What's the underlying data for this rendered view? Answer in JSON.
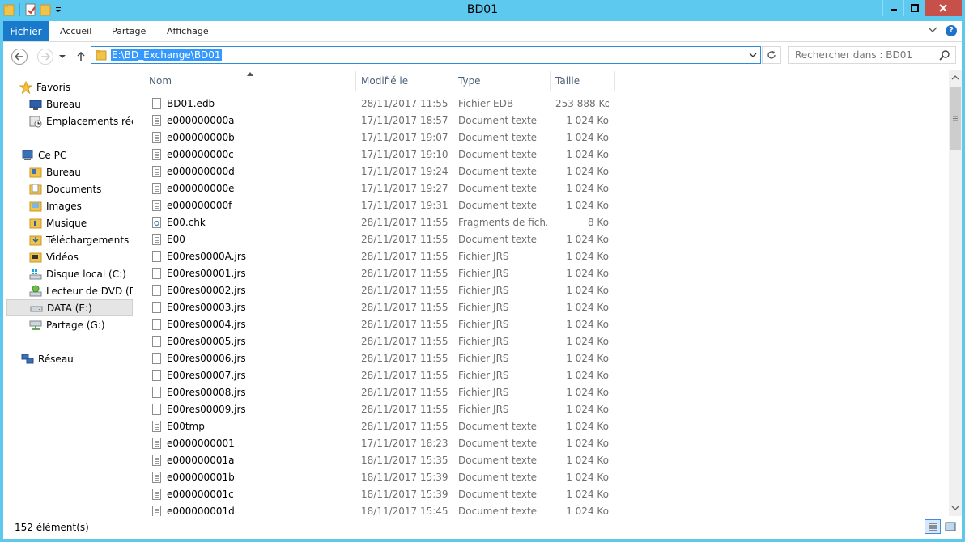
{
  "window": {
    "title": "BD01"
  },
  "ribbon": {
    "tabs": [
      {
        "label": "Fichier"
      },
      {
        "label": "Accueil"
      },
      {
        "label": "Partage"
      },
      {
        "label": "Affichage"
      }
    ]
  },
  "address": {
    "path": "E:\\BD_Exchange\\BD01"
  },
  "search": {
    "placeholder": "Rechercher dans : BD01"
  },
  "nav": {
    "favorites": "Favoris",
    "fav_items": [
      "Bureau",
      "Emplacements récents"
    ],
    "thispc": "Ce PC",
    "pc_items": [
      "Bureau",
      "Documents",
      "Images",
      "Musique",
      "Téléchargements",
      "Vidéos",
      "Disque local (C:)",
      "Lecteur de DVD (D:)",
      "DATA (E:)",
      "Partage (G:)"
    ],
    "network": "Réseau"
  },
  "columns": {
    "name": "Nom",
    "modified": "Modifié le",
    "type": "Type",
    "size": "Taille"
  },
  "files": [
    {
      "name": "BD01.edb",
      "date": "28/11/2017 11:55",
      "type": "Fichier EDB",
      "size": "253 888 Ko",
      "icon": "file-icon"
    },
    {
      "name": "e000000000a",
      "date": "17/11/2017 18:57",
      "type": "Document texte",
      "size": "1 024 Ko",
      "icon": "text-file-icon"
    },
    {
      "name": "e000000000b",
      "date": "17/11/2017 19:07",
      "type": "Document texte",
      "size": "1 024 Ko",
      "icon": "text-file-icon"
    },
    {
      "name": "e000000000c",
      "date": "17/11/2017 19:10",
      "type": "Document texte",
      "size": "1 024 Ko",
      "icon": "text-file-icon"
    },
    {
      "name": "e000000000d",
      "date": "17/11/2017 19:24",
      "type": "Document texte",
      "size": "1 024 Ko",
      "icon": "text-file-icon"
    },
    {
      "name": "e000000000e",
      "date": "17/11/2017 19:27",
      "type": "Document texte",
      "size": "1 024 Ko",
      "icon": "text-file-icon"
    },
    {
      "name": "e000000000f",
      "date": "17/11/2017 19:31",
      "type": "Document texte",
      "size": "1 024 Ko",
      "icon": "text-file-icon"
    },
    {
      "name": "E00.chk",
      "date": "28/11/2017 11:55",
      "type": "Fragments de fich...",
      "size": "8 Ko",
      "icon": "chk-file-icon"
    },
    {
      "name": "E00",
      "date": "28/11/2017 11:55",
      "type": "Document texte",
      "size": "1 024 Ko",
      "icon": "text-file-icon"
    },
    {
      "name": "E00res0000A.jrs",
      "date": "28/11/2017 11:55",
      "type": "Fichier JRS",
      "size": "1 024 Ko",
      "icon": "file-icon"
    },
    {
      "name": "E00res00001.jrs",
      "date": "28/11/2017 11:55",
      "type": "Fichier JRS",
      "size": "1 024 Ko",
      "icon": "file-icon"
    },
    {
      "name": "E00res00002.jrs",
      "date": "28/11/2017 11:55",
      "type": "Fichier JRS",
      "size": "1 024 Ko",
      "icon": "file-icon"
    },
    {
      "name": "E00res00003.jrs",
      "date": "28/11/2017 11:55",
      "type": "Fichier JRS",
      "size": "1 024 Ko",
      "icon": "file-icon"
    },
    {
      "name": "E00res00004.jrs",
      "date": "28/11/2017 11:55",
      "type": "Fichier JRS",
      "size": "1 024 Ko",
      "icon": "file-icon"
    },
    {
      "name": "E00res00005.jrs",
      "date": "28/11/2017 11:55",
      "type": "Fichier JRS",
      "size": "1 024 Ko",
      "icon": "file-icon"
    },
    {
      "name": "E00res00006.jrs",
      "date": "28/11/2017 11:55",
      "type": "Fichier JRS",
      "size": "1 024 Ko",
      "icon": "file-icon"
    },
    {
      "name": "E00res00007.jrs",
      "date": "28/11/2017 11:55",
      "type": "Fichier JRS",
      "size": "1 024 Ko",
      "icon": "file-icon"
    },
    {
      "name": "E00res00008.jrs",
      "date": "28/11/2017 11:55",
      "type": "Fichier JRS",
      "size": "1 024 Ko",
      "icon": "file-icon"
    },
    {
      "name": "E00res00009.jrs",
      "date": "28/11/2017 11:55",
      "type": "Fichier JRS",
      "size": "1 024 Ko",
      "icon": "file-icon"
    },
    {
      "name": "E00tmp",
      "date": "28/11/2017 11:55",
      "type": "Document texte",
      "size": "1 024 Ko",
      "icon": "text-file-icon"
    },
    {
      "name": "e0000000001",
      "date": "17/11/2017 18:23",
      "type": "Document texte",
      "size": "1 024 Ko",
      "icon": "text-file-icon"
    },
    {
      "name": "e000000001a",
      "date": "18/11/2017 15:35",
      "type": "Document texte",
      "size": "1 024 Ko",
      "icon": "text-file-icon"
    },
    {
      "name": "e000000001b",
      "date": "18/11/2017 15:39",
      "type": "Document texte",
      "size": "1 024 Ko",
      "icon": "text-file-icon"
    },
    {
      "name": "e000000001c",
      "date": "18/11/2017 15:39",
      "type": "Document texte",
      "size": "1 024 Ko",
      "icon": "text-file-icon"
    },
    {
      "name": "e000000001d",
      "date": "18/11/2017 15:45",
      "type": "Document texte",
      "size": "1 024 Ko",
      "icon": "text-file-icon"
    }
  ],
  "status": {
    "count": "152 élément(s)"
  },
  "colors": {
    "titlebar": "#5ec9ef",
    "file_tab": "#1979ca",
    "close": "#c7504b",
    "selection": "#3399ff"
  }
}
